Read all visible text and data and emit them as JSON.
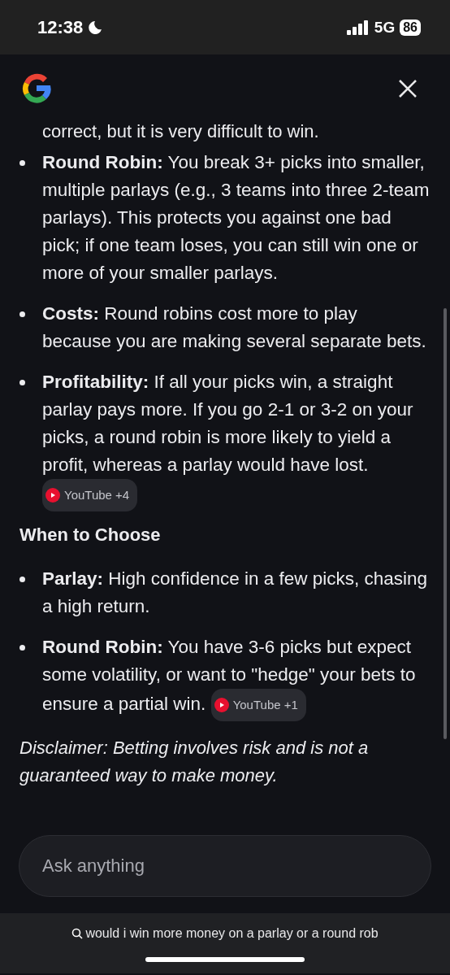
{
  "status_bar": {
    "time": "12:38",
    "network": "5G",
    "battery": "86"
  },
  "answer": {
    "lead_in": "correct, but it is very difficult to win.",
    "bullets_1": [
      {
        "term": "Round Robin:",
        "text": "You break 3+ picks into smaller, multiple parlays (e.g., 3 teams into three 2-team parlays). This protects you against one bad pick; if one team loses, you can still win one or more of your smaller parlays."
      },
      {
        "term": "Costs:",
        "text": "Round robins cost more to play because you are making several separate bets."
      },
      {
        "term": "Profitability:",
        "text": "If all your picks win, a straight parlay pays more. If you go 2-1 or 3-2 on your picks, a round robin is more likely to yield a profit, whereas a parlay would have lost.",
        "source": "YouTube +4"
      }
    ],
    "heading": "When to Choose",
    "bullets_2": [
      {
        "term": "Parlay:",
        "text": "High confidence in a few picks, chasing a high return."
      },
      {
        "term": "Round Robin:",
        "text": "You have 3-6 picks but expect some volatility, or want to \"hedge\" your bets to ensure a partial win.",
        "source": "YouTube +1"
      }
    ],
    "disclaimer": "Disclaimer: Betting involves risk and is not a guaranteed way to make money."
  },
  "input": {
    "placeholder": "Ask anything"
  },
  "query": "would i win more money on a parlay or a round rob"
}
